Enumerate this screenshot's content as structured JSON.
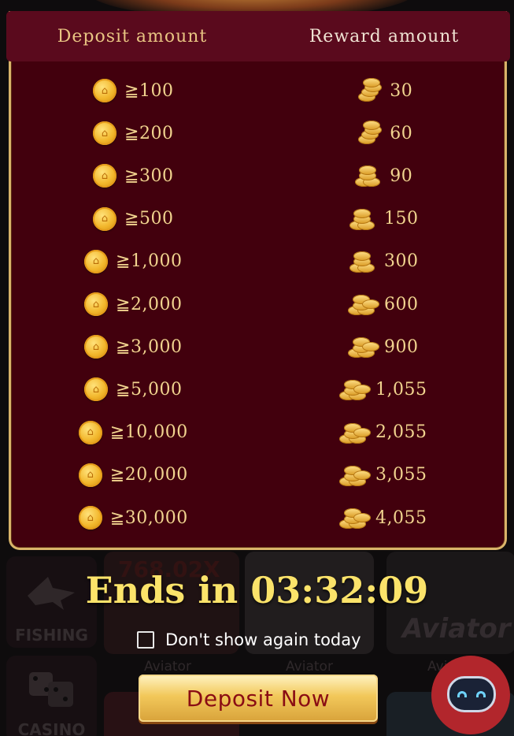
{
  "table": {
    "header": {
      "deposit_label": "Deposit amount",
      "reward_label": "Reward amount"
    },
    "rows": [
      {
        "deposit": "≧100",
        "reward": "30"
      },
      {
        "deposit": "≧200",
        "reward": "60"
      },
      {
        "deposit": "≧300",
        "reward": "90"
      },
      {
        "deposit": "≧500",
        "reward": "150"
      },
      {
        "deposit": "≧1,000",
        "reward": "300"
      },
      {
        "deposit": "≧2,000",
        "reward": "600"
      },
      {
        "deposit": "≧3,000",
        "reward": "900"
      },
      {
        "deposit": "≧5,000",
        "reward": "1,055"
      },
      {
        "deposit": "≧10,000",
        "reward": "2,055"
      },
      {
        "deposit": "≧20,000",
        "reward": "3,055"
      },
      {
        "deposit": "≧30,000",
        "reward": "4,055"
      }
    ]
  },
  "countdown": {
    "text": "Ends in 03:32:09"
  },
  "dont_show": {
    "label": "Don't show again today",
    "checked": false
  },
  "deposit_button": {
    "label": "Deposit Now"
  },
  "background": {
    "categories": [
      {
        "label": "FISHING",
        "icon": "shark-icon"
      },
      {
        "label": "CASINO",
        "icon": "dice-icon"
      }
    ],
    "game_labels": [
      "Aviator",
      "Aviator",
      "Aviator"
    ],
    "aviator_logo": "Aviator",
    "banner_text": "768.02X"
  },
  "colors": {
    "modal_bg": "#42000d",
    "header_bg": "#5a0a1d",
    "gold_text": "#f1d48f",
    "countdown": "#fbe36a",
    "button_text": "#8a0d14"
  }
}
